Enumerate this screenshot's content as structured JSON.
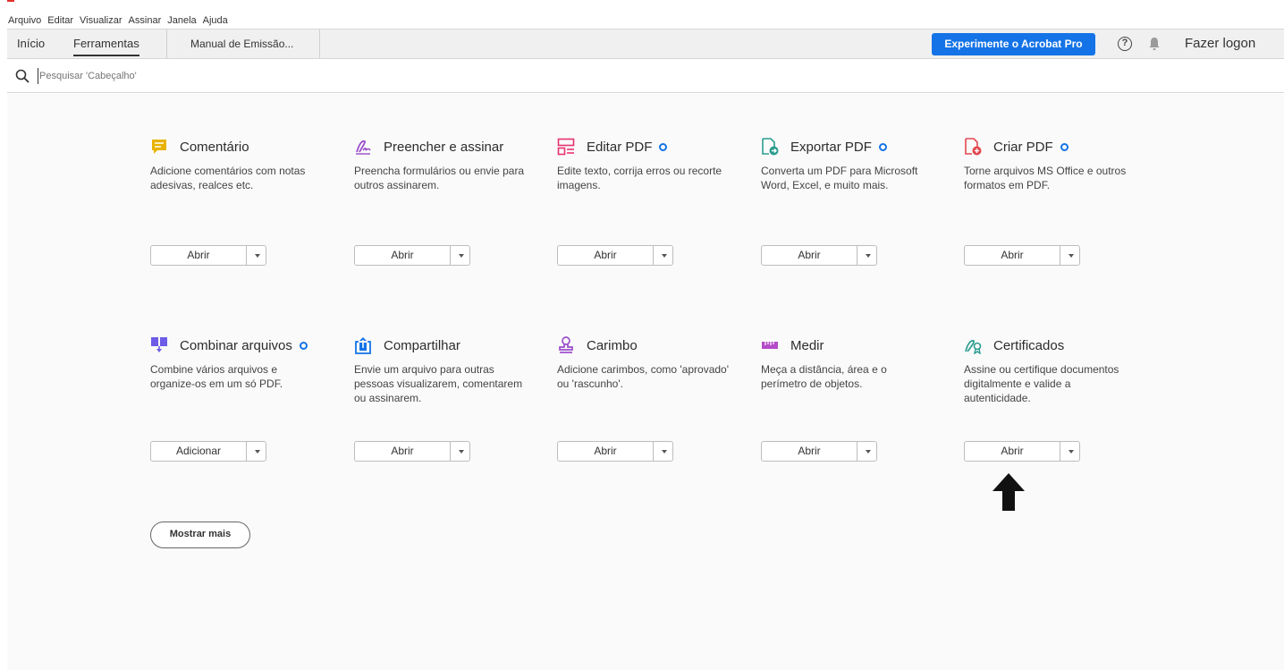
{
  "menubar": {
    "items": [
      "Arquivo",
      "Editar",
      "Visualizar",
      "Assinar",
      "Janela",
      "Ajuda"
    ]
  },
  "tabs": {
    "inicio": "Início",
    "ferramentas": "Ferramentas",
    "document": "Manual de Emissão..."
  },
  "header": {
    "pro_button": "Experimente o Acrobat Pro",
    "help": "?",
    "logon": "Fazer logon"
  },
  "search": {
    "placeholder": "Pesquisar 'Cabeçalho'"
  },
  "tools": [
    {
      "title": "Comentário",
      "desc": "Adicione comentários com notas adesivas, realces etc.",
      "button": "Abrir",
      "pro": false,
      "icon": "comment-icon",
      "color": "#e8b200"
    },
    {
      "title": "Preencher e assinar",
      "desc": "Preencha formulários ou envie para outros assinarem.",
      "button": "Abrir",
      "pro": false,
      "icon": "fill-sign-icon",
      "color": "#9b4dca"
    },
    {
      "title": "Editar PDF",
      "desc": "Edite texto, corrija erros ou recorte imagens.",
      "button": "Abrir",
      "pro": true,
      "icon": "edit-pdf-icon",
      "color": "#e8326e"
    },
    {
      "title": "Exportar PDF",
      "desc": "Converta um PDF para Microsoft Word, Excel, e muito mais.",
      "button": "Abrir",
      "pro": true,
      "icon": "export-pdf-icon",
      "color": "#2a9d8f"
    },
    {
      "title": "Criar PDF",
      "desc": "Torne arquivos MS Office e outros formatos em PDF.",
      "button": "Abrir",
      "pro": true,
      "icon": "create-pdf-icon",
      "color": "#e34850"
    },
    {
      "title": "Combinar arquivos",
      "desc": "Combine vários arquivos e organize-os em um só PDF.",
      "button": "Adicionar",
      "pro": true,
      "icon": "combine-files-icon",
      "color": "#6c5ce7"
    },
    {
      "title": "Compartilhar",
      "desc": "Envie um arquivo para outras pessoas visualizarem, comentarem ou assinarem.",
      "button": "Abrir",
      "pro": false,
      "icon": "share-icon",
      "color": "#1473e6"
    },
    {
      "title": "Carimbo",
      "desc": "Adicione carimbos, como 'aprovado' ou 'rascunho'.",
      "button": "Abrir",
      "pro": false,
      "icon": "stamp-icon",
      "color": "#9b4dca"
    },
    {
      "title": "Medir",
      "desc": "Meça a distância, área e o perímetro de objetos.",
      "button": "Abrir",
      "pro": false,
      "icon": "measure-icon",
      "color": "#b44bc8"
    },
    {
      "title": "Certificados",
      "desc": "Assine ou certifique documentos digitalmente e valide a autenticidade.",
      "button": "Abrir",
      "pro": false,
      "icon": "certificates-icon",
      "color": "#2a9d8f"
    }
  ],
  "show_more": "Mostrar mais",
  "colors": {
    "accent": "#1473e6",
    "annotation_arrow": "#000000"
  }
}
